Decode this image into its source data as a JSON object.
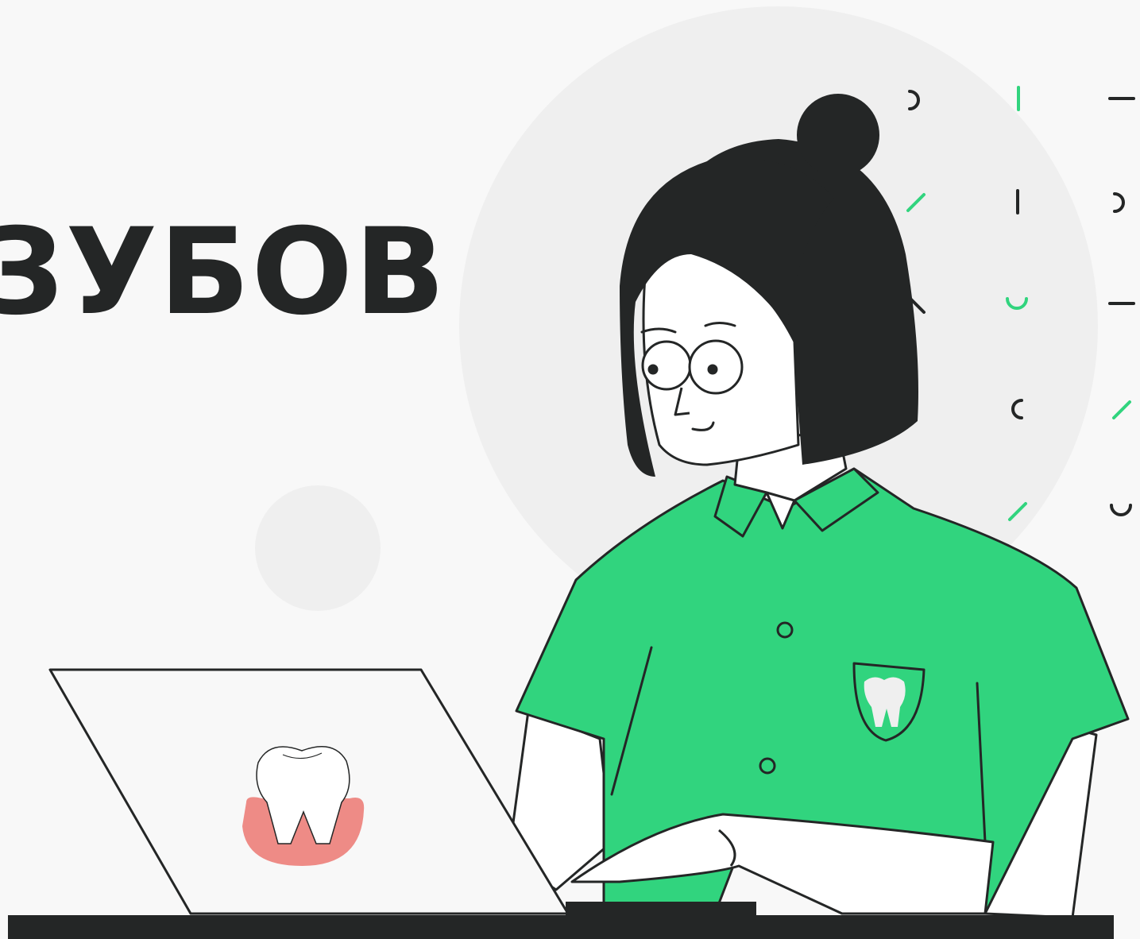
{
  "headline": {
    "text": "ЗУБОВ"
  },
  "colors": {
    "background": "#f8f8f8",
    "ink": "#242626",
    "accent_green": "#31d47e",
    "gum_pink": "#ee8b86",
    "circle_gray": "#efefef",
    "skin": "#ffffff"
  },
  "icons": {
    "laptop_logo": "tooth-with-gum-icon",
    "pocket_logo": "tooth-icon"
  }
}
